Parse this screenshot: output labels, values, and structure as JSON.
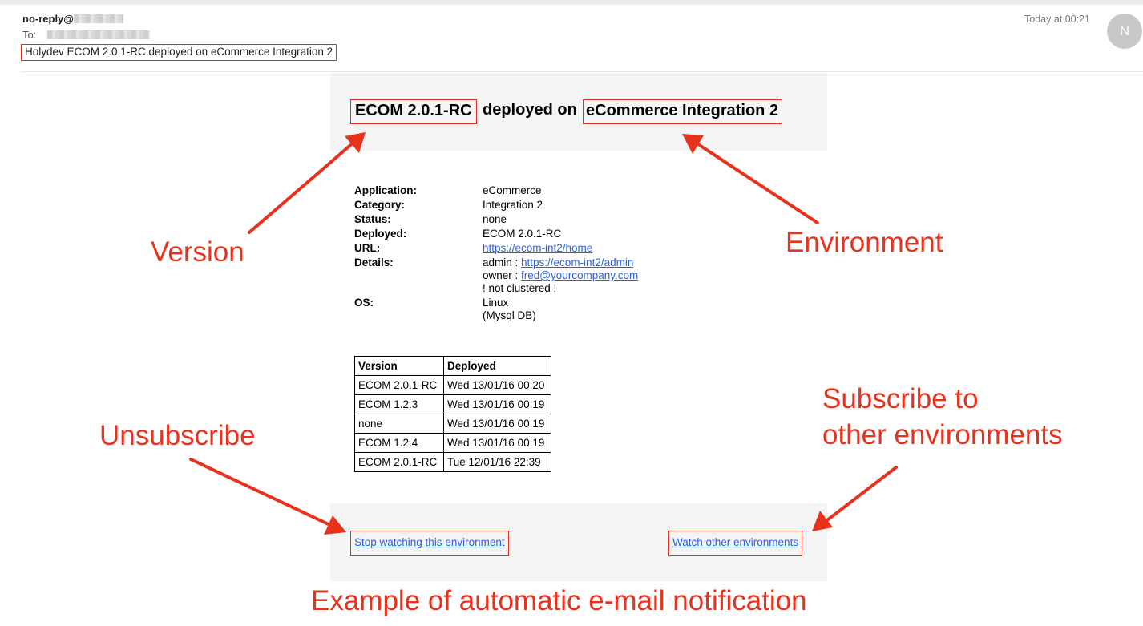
{
  "header": {
    "from_prefix": "no-reply@",
    "to_label": "To:",
    "subject": "Holydev ECOM 2.0.1-RC deployed on eCommerce Integration 2",
    "time": "Today at 00:21",
    "avatar_initial": "N"
  },
  "headline": {
    "version": "ECOM 2.0.1-RC",
    "middle": "deployed on",
    "environment": "eCommerce Integration 2"
  },
  "info": {
    "application_label": "Application:",
    "application_value": "eCommerce",
    "category_label": "Category:",
    "category_value": "Integration 2",
    "status_label": "Status:",
    "status_value": "none",
    "deployed_label": "Deployed:",
    "deployed_value": "ECOM 2.0.1-RC",
    "url_label": "URL:",
    "url_value": "https://ecom-int2/home",
    "details_label": "Details:",
    "details_admin_prefix": "admin : ",
    "details_admin_link": "https://ecom-int2/admin",
    "details_owner_prefix": "owner : ",
    "details_owner_link": "fred@yourcompany.com",
    "details_note": "! not clustered !",
    "os_label": "OS:",
    "os_value": "Linux",
    "os_db": "(Mysql DB)"
  },
  "history": {
    "headers": [
      "Version",
      "Deployed"
    ],
    "rows": [
      [
        "ECOM 2.0.1-RC",
        "Wed 13/01/16 00:20"
      ],
      [
        "ECOM 1.2.3",
        "Wed 13/01/16 00:19"
      ],
      [
        "none",
        "Wed 13/01/16 00:19"
      ],
      [
        "ECOM 1.2.4",
        "Wed 13/01/16 00:19"
      ],
      [
        "ECOM 2.0.1-RC",
        "Tue 12/01/16 22:39"
      ]
    ]
  },
  "footer": {
    "stop_watching": "Stop watching this environment",
    "watch_other": "Watch other environments"
  },
  "annotations": {
    "version": "Version",
    "environment": "Environment",
    "unsubscribe": "Unsubscribe",
    "subscribe_line1": "Subscribe to",
    "subscribe_line2": "other environments",
    "caption": "Example of automatic e-mail notification"
  },
  "colors": {
    "annotation_red": "#e8321e",
    "link_blue": "#2a62d8",
    "panel_gray": "#f4f4f4"
  },
  "icons": {
    "arrow": "red-arrow-icon"
  }
}
